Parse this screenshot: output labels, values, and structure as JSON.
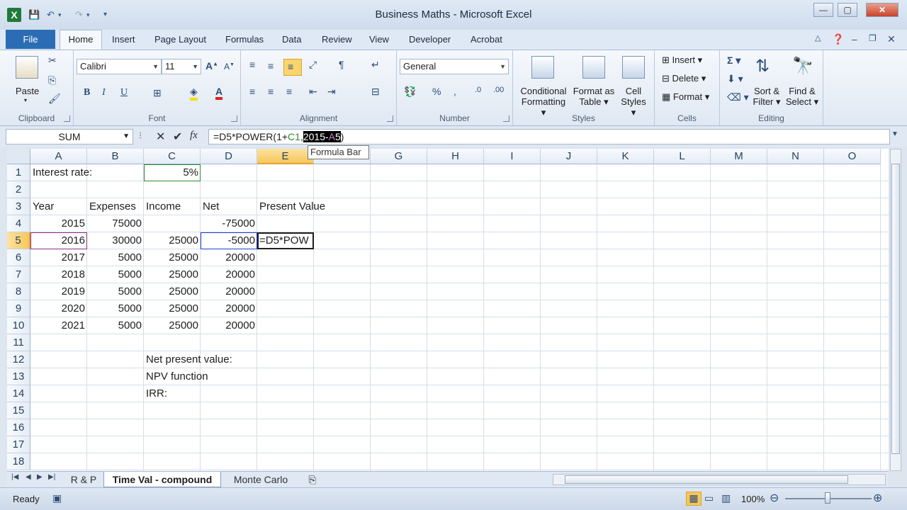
{
  "window": {
    "title": "Business Maths  -  Microsoft Excel",
    "app_icon": "X"
  },
  "qat": {
    "save_icon": "save-icon",
    "undo_icon": "undo-icon",
    "redo_icon": "redo-icon"
  },
  "tabs": [
    "File",
    "Home",
    "Insert",
    "Page Layout",
    "Formulas",
    "Data",
    "Review",
    "View",
    "Developer",
    "Acrobat"
  ],
  "ribbon": {
    "clipboard": {
      "label": "Clipboard",
      "paste": "Paste"
    },
    "font": {
      "label": "Font",
      "name": "Calibri",
      "size": "11"
    },
    "alignment": {
      "label": "Alignment"
    },
    "number": {
      "label": "Number",
      "format": "General"
    },
    "styles": {
      "label": "Styles",
      "conditional_1": "Conditional",
      "conditional_2": "Formatting",
      "format_as_1": "Format as",
      "format_as_2": "Table",
      "cell_1": "Cell",
      "cell_2": "Styles"
    },
    "cells": {
      "label": "Cells",
      "insert": "Insert",
      "delete": "Delete",
      "format": "Format"
    },
    "editing": {
      "label": "Editing",
      "sort_1": "Sort &",
      "sort_2": "Filter",
      "find_1": "Find &",
      "find_2": "Select"
    }
  },
  "formula_bar": {
    "name_box": "SUM",
    "formula_pre": "=D5*POWER(1+",
    "formula_ref1": "C1",
    "formula_comma": ",",
    "formula_sel_a": "2015-",
    "formula_sel_ref": "A",
    "formula_sel_b": "5",
    "formula_post": ")",
    "tooltip": "Formula Bar"
  },
  "grid": {
    "columns": [
      "A",
      "B",
      "C",
      "D",
      "E",
      "F",
      "G",
      "H",
      "I",
      "J",
      "K",
      "L",
      "M",
      "N",
      "O"
    ],
    "rows": [
      "1",
      "2",
      "3",
      "4",
      "5",
      "6",
      "7",
      "8",
      "9",
      "10",
      "11",
      "12",
      "13",
      "14",
      "15",
      "16",
      "17",
      "18"
    ],
    "cells": {
      "A1": "Interest rate:",
      "C1": "5%",
      "A3": "Year",
      "B3": "Expenses",
      "C3": "Income",
      "D3": "Net",
      "E3": "Present Value",
      "A4": "2015",
      "B4": "75000",
      "D4": "-75000",
      "A5": "2016",
      "B5": "30000",
      "C5": "25000",
      "D5": "-5000",
      "E5": "=D5*POW",
      "A6": "2017",
      "B6": "5000",
      "C6": "25000",
      "D6": "20000",
      "A7": "2018",
      "B7": "5000",
      "C7": "25000",
      "D7": "20000",
      "A8": "2019",
      "B8": "5000",
      "C8": "25000",
      "D8": "20000",
      "A9": "2020",
      "B9": "5000",
      "C9": "25000",
      "D9": "20000",
      "A10": "2021",
      "B10": "5000",
      "C10": "25000",
      "D10": "20000",
      "C12": "Net present value:",
      "C13": "NPV function",
      "C14": "IRR:"
    }
  },
  "sheets": [
    "R & P",
    "Time Val - compound",
    "Monte Carlo"
  ],
  "status": {
    "mode": "Ready",
    "zoom": "100%"
  },
  "colors": {
    "ref_c1": "#2e8b2e",
    "ref_a5": "#8b2e8b",
    "ref_d5": "#1f3fd6",
    "accent": "#2a6db5"
  }
}
